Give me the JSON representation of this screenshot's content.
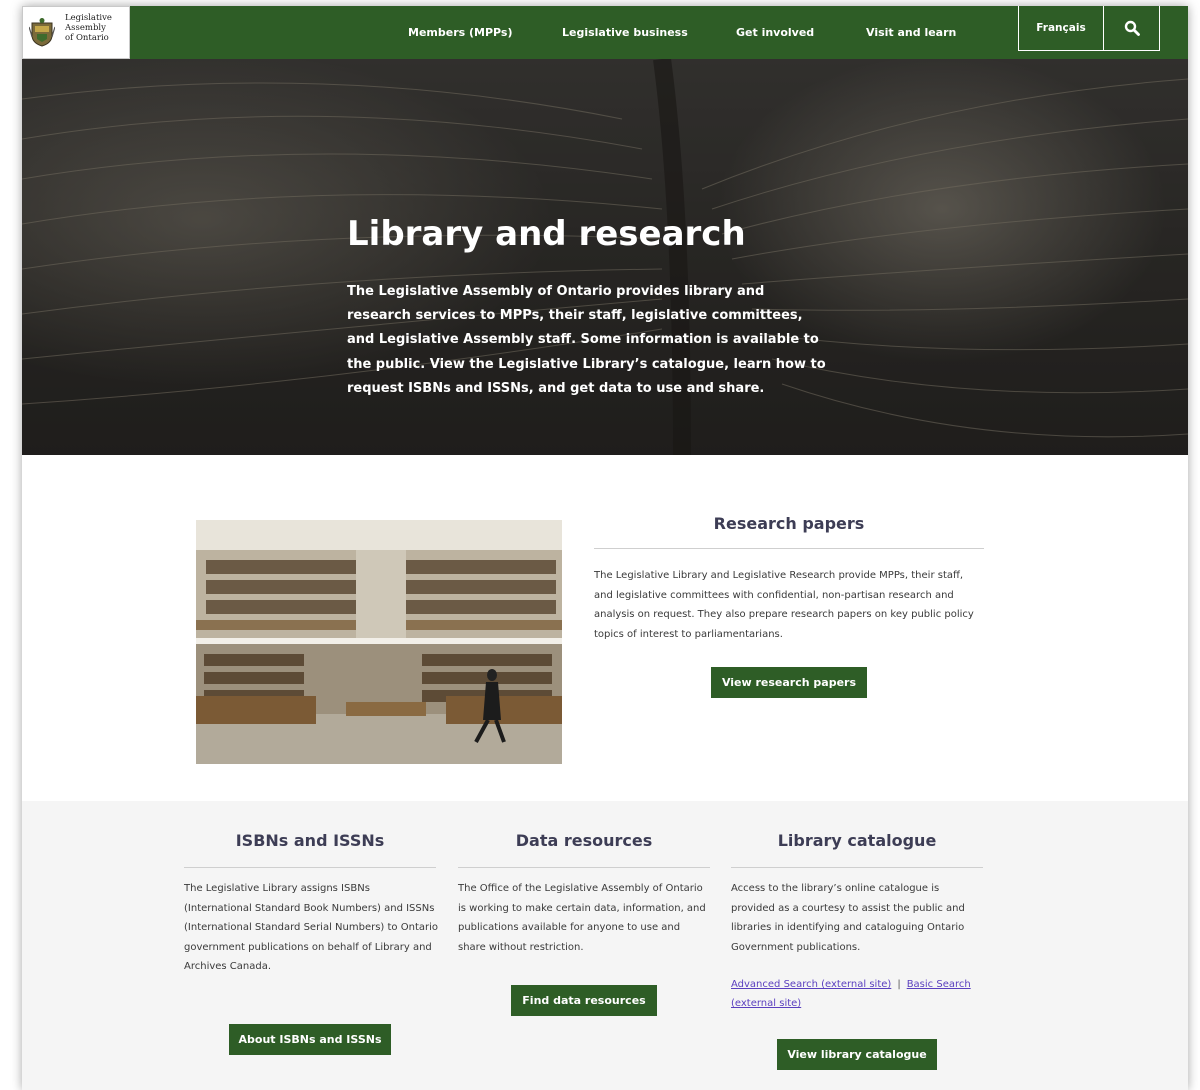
{
  "logo": {
    "line1": "Legislative",
    "line2": "Assembly",
    "line3": "of Ontario"
  },
  "nav": {
    "items": [
      {
        "label": "Members (MPPs)"
      },
      {
        "label": "Legislative business"
      },
      {
        "label": "Get involved"
      },
      {
        "label": "Visit and learn"
      }
    ],
    "language": "Français",
    "search_icon": "search-icon"
  },
  "hero": {
    "title": "Library and research",
    "description": "The Legislative Assembly of Ontario provides library and research services to MPPs, their staff, legislative committees, and Legislative Assembly staff. Some information is available to the public. View the Legislative Library’s catalogue, learn how to request ISBNs and ISSNs, and get data to use and share."
  },
  "research": {
    "title": "Research papers",
    "description": "The Legislative Library and Legislative Research provide MPPs, their staff, and legislative committees with confidential, non-partisan research and analysis on request. They also prepare research papers on key public policy topics of interest to parliamentarians.",
    "button": "View research papers"
  },
  "isbn": {
    "title": "ISBNs and ISSNs",
    "description": "The Legislative Library assigns ISBNs (International Standard Book Numbers) and ISSNs (International Standard Serial Numbers) to Ontario government publications on behalf of Library and Archives Canada.",
    "button": "About ISBNs and ISSNs"
  },
  "data_resources": {
    "title": "Data resources",
    "description": "The Office of the Legislative Assembly of Ontario is working to make certain data, information, and publications available for anyone to use and share without restriction.",
    "button": "Find data resources"
  },
  "catalogue": {
    "title": "Library catalogue",
    "description": "Access to the library’s online catalogue is provided as a courtesy to assist the public and libraries in identifying and cataloguing Ontario Government publications.",
    "link_advanced": "Advanced Search (external site)",
    "separator": "|",
    "link_basic": "Basic Search (external site)",
    "button": "View library catalogue"
  },
  "colors": {
    "brand_green": "#2e5d26",
    "heading": "#3d3d55",
    "link": "#5a3fbf"
  }
}
